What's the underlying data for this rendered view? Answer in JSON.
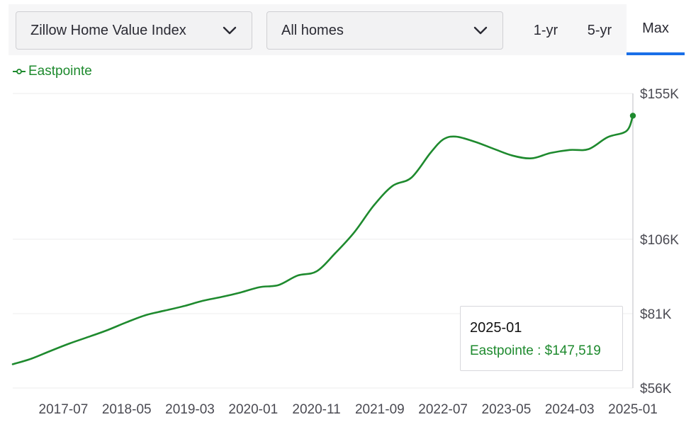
{
  "controls": {
    "metric_select": {
      "value": "Zillow Home Value Index",
      "icon": "chevron-down-icon"
    },
    "home_type_select": {
      "value": "All homes",
      "icon": "chevron-down-icon"
    },
    "ranges": [
      {
        "label": "1-yr",
        "active": false
      },
      {
        "label": "5-yr",
        "active": false
      },
      {
        "label": "Max",
        "active": true
      }
    ]
  },
  "legend": {
    "label": "Eastpointe",
    "color": "#1e8a2e"
  },
  "tooltip": {
    "date": "2025-01",
    "text": "Eastpointe : $147,519"
  },
  "chart_data": {
    "type": "line",
    "title": "",
    "xlabel": "",
    "ylabel": "",
    "x_ticks": [
      "2017-07",
      "2018-05",
      "2019-03",
      "2020-01",
      "2020-11",
      "2021-09",
      "2022-07",
      "2023-05",
      "2024-03",
      "2025-01"
    ],
    "y_ticks": [
      {
        "value": 155000,
        "label": "$155K"
      },
      {
        "value": 106000,
        "label": "$106K"
      },
      {
        "value": 81000,
        "label": "$81K"
      },
      {
        "value": 56000,
        "label": "$56K"
      }
    ],
    "ylim": [
      56000,
      155000
    ],
    "x_range": [
      "2016-11",
      "2025-01"
    ],
    "grid": true,
    "series": [
      {
        "name": "Eastpointe",
        "color": "#1e8a2e",
        "points": [
          [
            "2016-11",
            64000
          ],
          [
            "2017-02",
            65900
          ],
          [
            "2017-05",
            68500
          ],
          [
            "2017-08",
            71000
          ],
          [
            "2017-11",
            73200
          ],
          [
            "2018-02",
            75500
          ],
          [
            "2018-05",
            78100
          ],
          [
            "2018-08",
            80500
          ],
          [
            "2018-11",
            82000
          ],
          [
            "2019-02",
            83500
          ],
          [
            "2019-05",
            85300
          ],
          [
            "2019-08",
            86600
          ],
          [
            "2019-11",
            88100
          ],
          [
            "2020-02",
            89900
          ],
          [
            "2020-05",
            90600
          ],
          [
            "2020-08",
            93800
          ],
          [
            "2020-11",
            95200
          ],
          [
            "2021-02",
            101400
          ],
          [
            "2021-05",
            108400
          ],
          [
            "2021-08",
            117200
          ],
          [
            "2021-11",
            123900
          ],
          [
            "2022-02",
            126700
          ],
          [
            "2022-05",
            135000
          ],
          [
            "2022-07",
            139500
          ],
          [
            "2022-09",
            140500
          ],
          [
            "2022-12",
            138800
          ],
          [
            "2023-03",
            136400
          ],
          [
            "2023-06",
            134100
          ],
          [
            "2023-09",
            133200
          ],
          [
            "2023-12",
            135000
          ],
          [
            "2024-03",
            136000
          ],
          [
            "2024-06",
            136300
          ],
          [
            "2024-09",
            140300
          ],
          [
            "2024-12",
            142400
          ],
          [
            "2025-01",
            147519
          ]
        ]
      }
    ]
  }
}
